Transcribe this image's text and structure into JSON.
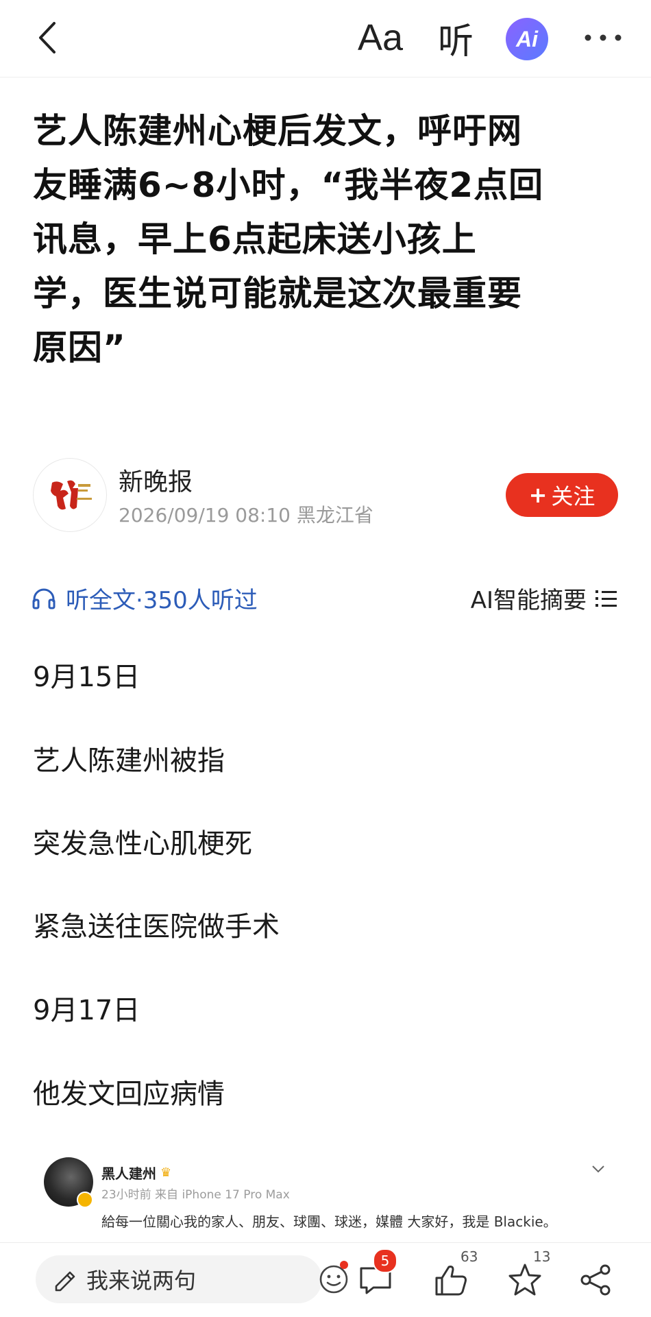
{
  "toolbar": {
    "font_label": "Aa",
    "listen_label": "听",
    "ai_label": "Ai"
  },
  "article": {
    "title_lines": [
      "艺人陈建州心梗后发文，呼吁网",
      "友睡满6~8小时，“我半夜2点回",
      "讯息，早上6点起床送小孩上",
      "学，医生说可能就是这次最重要",
      "原因”"
    ]
  },
  "author": {
    "name": "新晚报",
    "meta": "2026/09/19 08:10 黑龙江省",
    "follow_label": "关注",
    "follow_plus": "+"
  },
  "listen": {
    "label": "听全文·350人听过"
  },
  "summary": {
    "label": "AI智能摘要"
  },
  "paragraphs": [
    "9月15日",
    "艺人陈建州被指",
    "突发急性心肌梗死",
    "紧急送往医院做手术",
    "9月17日",
    "他发文回应病情"
  ],
  "embed": {
    "name": "黑人建州",
    "meta": "23小时前 来自 iPhone 17 Pro Max",
    "text": "給每一位關心我的家人、朋友、球團、球迷，媒體 大家好，我是 Blackie。"
  },
  "bottom": {
    "comment_placeholder": "我来说两句",
    "comment_count": "5",
    "like_count": "63",
    "fav_count": "13"
  },
  "colors": {
    "accent_red": "#e8311f",
    "link_blue": "#2c5cb8",
    "ai_gradient_start": "#8a63ff",
    "ai_gradient_end": "#5a7bff"
  }
}
